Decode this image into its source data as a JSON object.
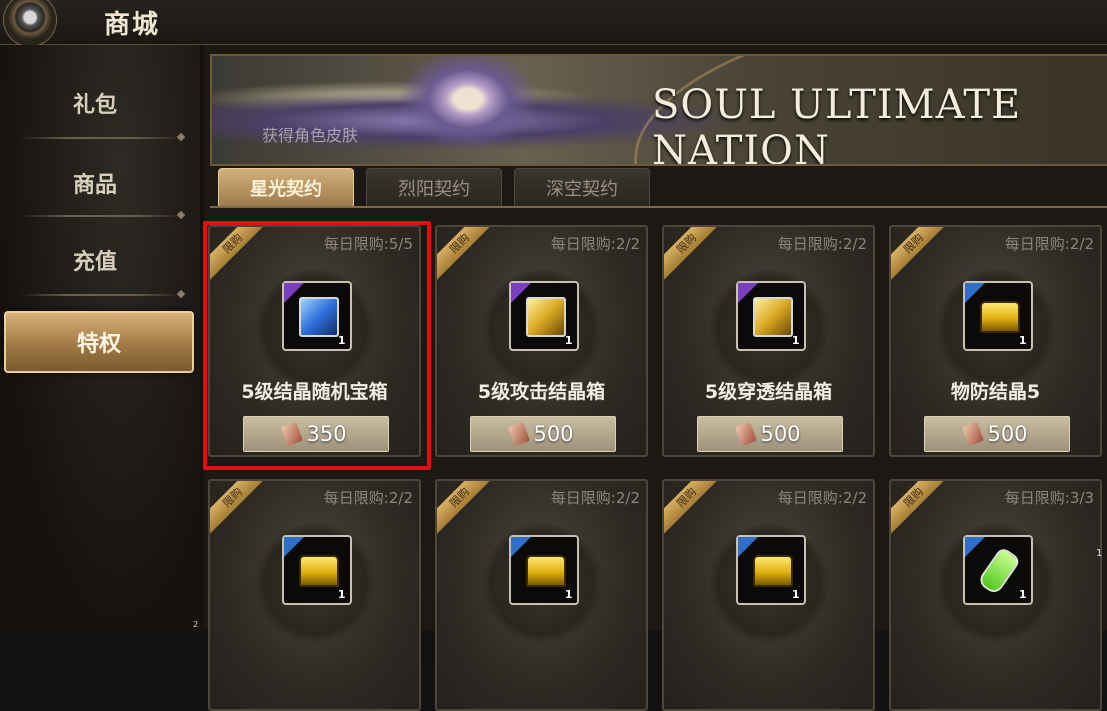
{
  "header": {
    "title": "商城",
    "emblem_icon": "orb-emblem-icon"
  },
  "sidebar": {
    "items": [
      {
        "label": "礼包",
        "active": false
      },
      {
        "label": "商品",
        "active": false
      },
      {
        "label": "充值",
        "active": false
      },
      {
        "label": "特权",
        "active": true
      }
    ]
  },
  "banner": {
    "title": "SOUL ULTIMATE NATION",
    "subtitle": "获得角色皮肤"
  },
  "tabs": [
    {
      "label": "星光契约",
      "active": true
    },
    {
      "label": "烈阳契约",
      "active": false
    },
    {
      "label": "深空契约",
      "active": false
    }
  ],
  "cards": [
    {
      "ribbon": "限购",
      "limit": "每日限购:5/5",
      "name": "5级结晶随机宝箱",
      "price": "350",
      "count": "1",
      "icon": "blue-crystal-box-icon",
      "corner": "purple"
    },
    {
      "ribbon": "限购",
      "limit": "每日限购:2/2",
      "name": "5级攻击结晶箱",
      "price": "500",
      "count": "1",
      "icon": "gold-crystal-box-icon",
      "corner": "purple"
    },
    {
      "ribbon": "限购",
      "limit": "每日限购:2/2",
      "name": "5级穿透结晶箱",
      "price": "500",
      "count": "1",
      "icon": "gold-crystal-box-icon",
      "corner": "purple"
    },
    {
      "ribbon": "限购",
      "limit": "每日限购:2/2",
      "name": "物防结晶5",
      "price": "500",
      "count": "1",
      "icon": "gold-chest-icon",
      "corner": "blue"
    },
    {
      "ribbon": "限购",
      "limit": "每日限购:2/2",
      "count": "1",
      "icon": "gold-chest-icon",
      "corner": "blue"
    },
    {
      "ribbon": "限购",
      "limit": "每日限购:2/2",
      "count": "1",
      "icon": "gold-chest-icon",
      "corner": "blue"
    },
    {
      "ribbon": "限购",
      "limit": "每日限购:2/2",
      "count": "1",
      "icon": "gold-chest-icon",
      "corner": "blue"
    },
    {
      "ribbon": "限购",
      "limit": "每日限购:3/3",
      "count": "1",
      "icon": "green-potion-icon",
      "corner": "blue"
    }
  ],
  "page_marker_left": "2",
  "page_marker_right": "1",
  "colors": {
    "highlight": "#e01010",
    "accent_gold": "#c9a468"
  }
}
